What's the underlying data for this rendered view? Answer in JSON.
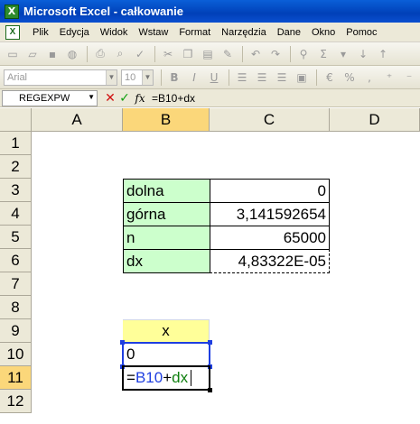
{
  "window": {
    "title": "Microsoft Excel - całkowanie",
    "icon": "excel-icon"
  },
  "menu": [
    "Plik",
    "Edycja",
    "Widok",
    "Wstaw",
    "Format",
    "Narzędzia",
    "Dane",
    "Okno",
    "Pomoc"
  ],
  "toolbar2": {
    "font_name": "Arial",
    "font_size": "10",
    "bold": "B",
    "italic": "I",
    "underline": "U",
    "percent": "%",
    "sigma": "Σ"
  },
  "formula_bar": {
    "name_box": "REGEXPW",
    "content": "=B10+dx",
    "fx": "fx"
  },
  "columns": [
    "A",
    "B",
    "C",
    "D"
  ],
  "rows": [
    "1",
    "2",
    "3",
    "4",
    "5",
    "6",
    "7",
    "8",
    "9",
    "10",
    "11",
    "12"
  ],
  "cells": {
    "B3": "dolna",
    "C3": "0",
    "B4": "górna",
    "C4": "3,141592654",
    "B5": "n",
    "C5": "65000",
    "B6": "dx",
    "C6": "4,83322E-05",
    "B9": "x",
    "B10": "0",
    "B11_eq": "=",
    "B11_ref": "B10",
    "B11_plus": "+",
    "B11_name": "dx"
  },
  "colors": {
    "green_fill": "#ccffcc",
    "yellow_fill": "#ffff99",
    "ref_blue": "#1f3fe0",
    "ref_green": "#108010"
  }
}
